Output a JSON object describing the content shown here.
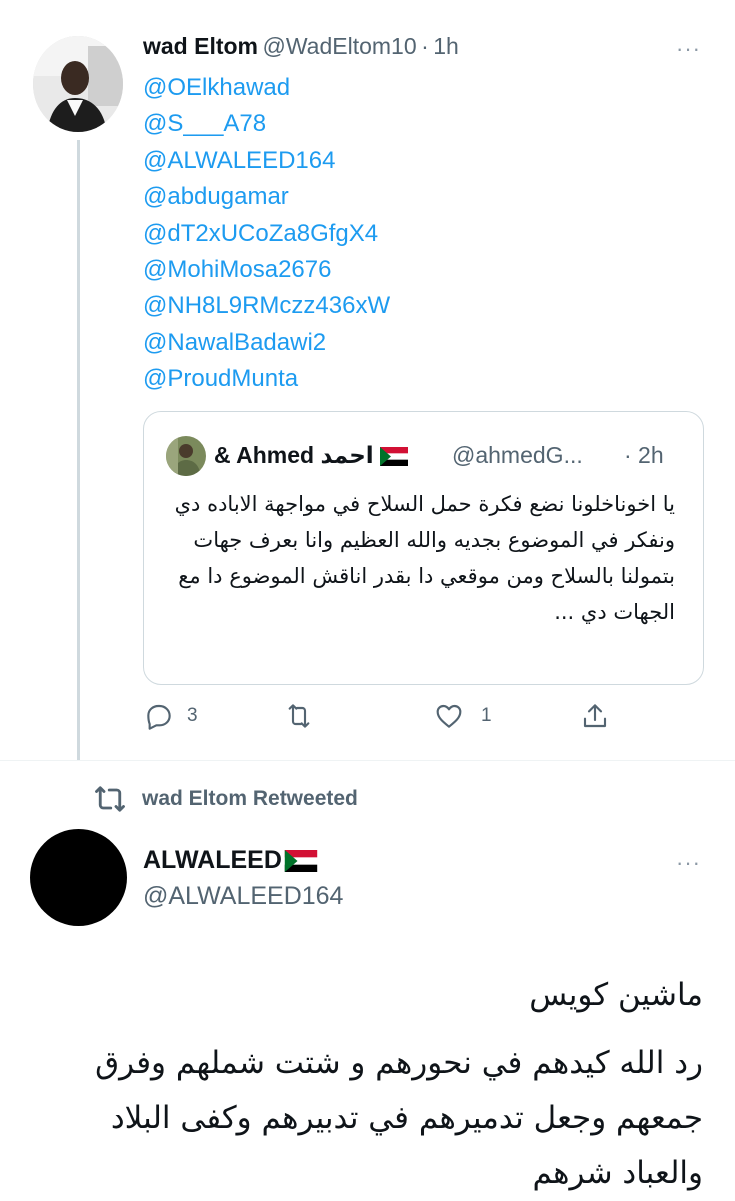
{
  "tweet1": {
    "author_name": "wad Eltom",
    "author_handle": "@WadEltom10",
    "separator": "·",
    "time": "1h",
    "more": "···",
    "mentions": [
      "@OElkhawad",
      "@S___A78",
      "@ALWALEED164",
      "@abdugamar",
      "@dT2xUCoZa8GfgX4",
      "@MohiMosa2676",
      "@NH8L9RMczz436xW",
      "@NawalBadawi2",
      "@ProudMunta"
    ],
    "quote": {
      "name": "& Ahmed احمد",
      "handle": "@ahmedG...",
      "time": "· 2h",
      "text": "يا اخوناخلونا نضع فكرة حمل السلاح في مواجهة الاباده دي ونفكر في الموضوع بجديه والله العظيم وانا بعرف جهات بتمولنا بالسلاح ومن موقعي دا بقدر اناقش الموضوع دا مع الجهات دي ..."
    },
    "actions": {
      "reply_count": "3",
      "retweet_count": "",
      "like_count": "1"
    }
  },
  "retweet_label": "wad Eltom Retweeted",
  "tweet2": {
    "author_name": "ALWALEED",
    "author_handle": "@ALWALEED164",
    "more": "···",
    "body_line1": "ماشين كويس",
    "body_line2": "رد الله كيدهم في نحورهم و شتت شملهم وفرق جمعهم وجعل تدميرهم في تدبيرهم وكفى البلاد والعباد شرهم"
  },
  "colors": {
    "link": "#1d9bf0",
    "secondary_text": "#536471",
    "border": "#cfd9de",
    "flag_red": "#d21034",
    "flag_white": "#ffffff",
    "flag_black": "#000000",
    "flag_green": "#007229"
  },
  "icons": [
    "reply-icon",
    "retweet-icon",
    "like-icon",
    "share-icon",
    "more-icon",
    "sudan-flag-icon"
  ]
}
